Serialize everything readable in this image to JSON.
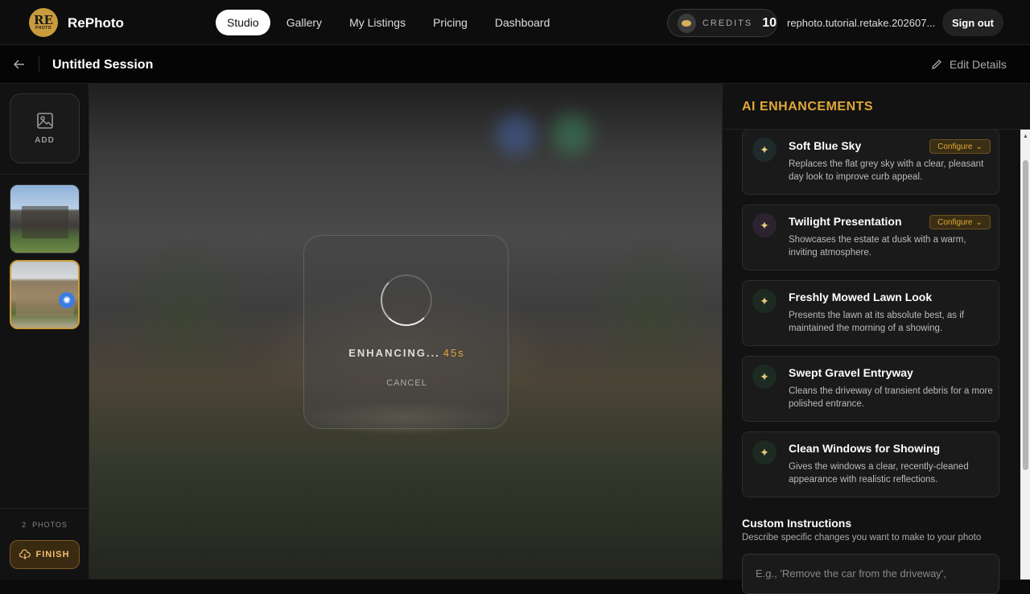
{
  "brand": {
    "logo_top": "RE",
    "logo_bottom": "PHOTO",
    "name": "RePhoto"
  },
  "nav": {
    "items": [
      "Studio",
      "Gallery",
      "My Listings",
      "Pricing",
      "Dashboard"
    ],
    "active": "Studio"
  },
  "credits": {
    "label": "CREDITS",
    "value": "10"
  },
  "user": {
    "name": "rephoto.tutorial.retake.202607..."
  },
  "signout_label": "Sign out",
  "session": {
    "title": "Untitled Session",
    "edit_label": "Edit Details"
  },
  "sidebar": {
    "add_label": "ADD",
    "photo_count": "2",
    "photos_label": "PHOTOS",
    "finish_label": "FINISH"
  },
  "loader": {
    "status": "ENHANCING...",
    "seconds": "45s",
    "cancel_label": "CANCEL"
  },
  "panel": {
    "title": "AI ENHANCEMENTS",
    "configure_label": "Configure",
    "cards": [
      {
        "title": "Soft Blue Sky",
        "desc": "Replaces the flat grey sky with a clear, pleasant day look to improve curb appeal."
      },
      {
        "title": "Twilight Presentation",
        "desc": "Showcases the estate at dusk with a warm, inviting atmosphere."
      },
      {
        "title": "Freshly Mowed Lawn Look",
        "desc": "Presents the lawn at its absolute best, as if maintained the morning of a showing."
      },
      {
        "title": "Swept Gravel Entryway",
        "desc": "Cleans the driveway of transient debris for a more polished entrance."
      },
      {
        "title": "Clean Windows for Showing",
        "desc": "Gives the windows a clear, recently-cleaned appearance with realistic reflections."
      }
    ],
    "custom_title": "Custom Instructions",
    "custom_desc": "Describe specific changes you want to make to your photo",
    "custom_placeholder": "E.g., 'Remove the car from the driveway',"
  },
  "colors": {
    "accent": "#e0a838",
    "spinner_badge": "#3c7be0"
  }
}
